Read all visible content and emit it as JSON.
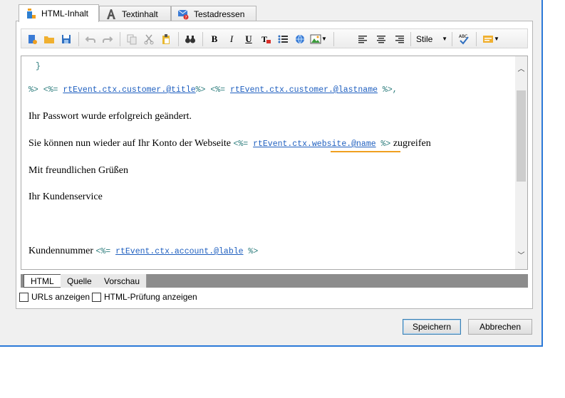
{
  "tabs": [
    {
      "label": "HTML-Inhalt",
      "icon": "html-content-icon",
      "active": true
    },
    {
      "label": "Textinhalt",
      "icon": "text-a-icon",
      "active": false
    },
    {
      "label": "Testadressen",
      "icon": "mail-test-icon",
      "active": false
    }
  ],
  "toolbar": {
    "style_label": "Stile",
    "bold": "B",
    "italic": "I",
    "underline": "U"
  },
  "editor": {
    "lines": [
      {
        "pre": "}",
        "tpl": true
      },
      {
        "tpl_text_1": "%> <%= ",
        "ref_1": "rtEvent.ctx.customer.@title",
        "tpl_text_2": "%> <%= ",
        "ref_2": "rtEvent.ctx.customer.@lastname",
        "tpl_text_3": " %>,"
      }
    ],
    "brace": "}",
    "salutation": {
      "open1": "%> <%= ",
      "ref1": "rtEvent.ctx.customer.@title",
      "close1": "%> <%= ",
      "ref2": "rtEvent.ctx.customer.@lastname",
      "close2": " %>,"
    },
    "para1": "Ihr Passwort wurde erfolgreich geändert.",
    "para2": {
      "text": "Sie können nun wieder auf Ihr Konto der Webseite",
      "open": "<%= ",
      "ref": "rtEvent.ctx.website.@name",
      "close": " %>",
      "after": "zugreifen"
    },
    "para3": "Mit freundlichen Grüßen",
    "para4": "Ihr Kundenservice",
    "para5": {
      "text": "Kundennummer",
      "open": "<%= ",
      "ref": "rtEvent.ctx.account.@lable",
      "close": " %>"
    }
  },
  "mode_tabs": [
    {
      "label": "HTML",
      "active": true
    },
    {
      "label": "Quelle",
      "active": false
    },
    {
      "label": "Vorschau",
      "active": false
    }
  ],
  "options": {
    "show_urls": "URLs anzeigen",
    "show_html_check": "HTML-Prüfung anzeigen"
  },
  "buttons": {
    "save": "Speichern",
    "cancel": "Abbrechen"
  },
  "colors": {
    "window_border": "#2b79d8",
    "template_code": "#2c7c7c",
    "template_ref": "#2060c0",
    "highlight_underline": "#f0a020"
  }
}
